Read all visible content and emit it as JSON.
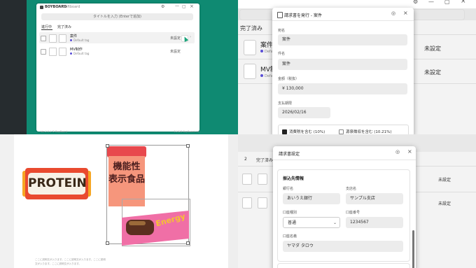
{
  "app": {
    "name": "BOYBOARD",
    "window_subtitle": "Softboard",
    "search_placeholder": "タイトルを入力 (Enterで追加)",
    "tabs": [
      "進行中",
      "完了済み"
    ]
  },
  "tasks": [
    {
      "name": "案件",
      "tag": "Default tag",
      "status": "未設定"
    },
    {
      "name": "MV制作",
      "tag": "Default tag",
      "status": "未設定"
    }
  ],
  "footer": {
    "left": "Ver.2.0.1 ©  BoyBoard",
    "right": "©2026 BoyBoard Inc."
  },
  "panel2": {
    "tab": "完了済み",
    "tasks": [
      {
        "name": "案件",
        "tag": "Default",
        "status": "未設定"
      },
      {
        "name": "MV制",
        "tag": "Default",
        "status": "未設定"
      }
    ],
    "modal": {
      "title": "請求書を発行 - 案件",
      "fields": [
        {
          "label": "宛名",
          "value": "案件"
        },
        {
          "label": "件名",
          "value": "案件"
        },
        {
          "label": "金額（税抜）",
          "value": "¥  130,000"
        },
        {
          "label": "支払期限",
          "value": "2026/02/16"
        }
      ],
      "checkboxes": [
        {
          "label": "消費税を含む (10%)",
          "checked": true
        },
        {
          "label": "源泉徴収を含む (10.21%)",
          "checked": false
        }
      ]
    }
  },
  "panel3": {
    "label_protein": "PROTEIN",
    "label_box": "機能性\n表示食品",
    "label_energy": "Energy",
    "caption_lines": [
      "ここに説明文が入ります。ここに説明文が入ります。ここに説明",
      "文が入ります。ここに説明文が入ります。"
    ]
  },
  "panel4": {
    "tab_num": "2",
    "tab_label": "完了済み",
    "statuses": [
      "未設定",
      "未設定"
    ],
    "modal": {
      "title": "請求書設定",
      "section": "振込先情報",
      "fields": [
        {
          "label": "銀行名",
          "value": "あいうえ銀行"
        },
        {
          "label": "支店名",
          "value": "サンプル支店"
        },
        {
          "label": "口座種別",
          "value": "普通"
        },
        {
          "label": "口座番号",
          "value": "1234567"
        },
        {
          "label": "口座名義",
          "value": "ヤマダ タロウ"
        }
      ]
    }
  },
  "colors": {
    "teal_bg": "#0f8a72",
    "accent_green": "#1aa37a",
    "tag_dot": "#5a4fd6"
  }
}
